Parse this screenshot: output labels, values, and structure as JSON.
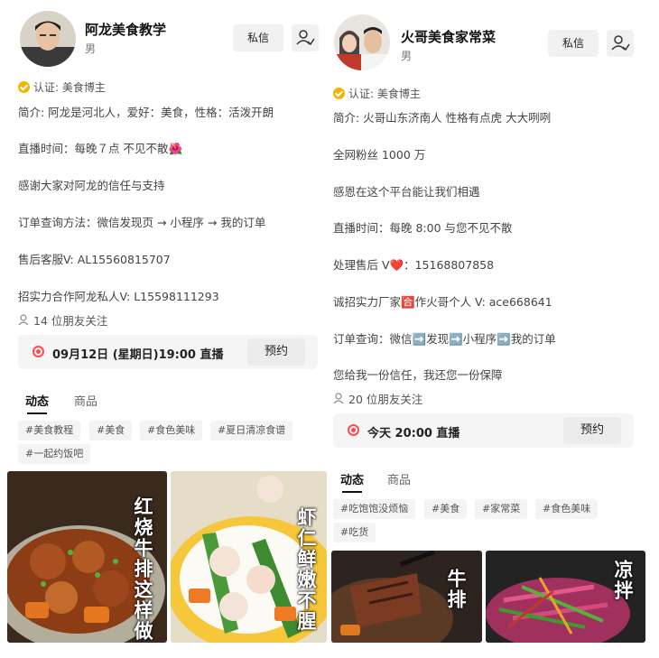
{
  "left": {
    "name": "阿龙美食教学",
    "gender": "男",
    "message_label": "私信",
    "verification": "认证: 美食博主",
    "bio_lines": [
      "简介: 阿龙是河北人，爱好：美食，性格：活泼开朗",
      "直播时间：每晚７点  不见不散🌺",
      "感谢大家对阿龙的信任与支持",
      "订单查询方法：微信发现页 → 小程序 → 我的订单",
      "售后客服V:    AL15560815707",
      "招实力合作阿龙私人V:  L15598111293"
    ],
    "friends": "14 位朋友关注",
    "live": {
      "text": "09月12日 (星期日)19:00 直播",
      "button": "预约"
    },
    "tabs": [
      "动态",
      "商品"
    ],
    "tags": [
      "#美食教程",
      "#美食",
      "#食色美味",
      "#夏日清凉食谱",
      "#一起约饭吧"
    ],
    "thumbnails": [
      {
        "caption": "红烧牛排这样做"
      },
      {
        "caption": "虾仁鲜嫩不腥"
      }
    ]
  },
  "right": {
    "name": "火哥美食家常菜",
    "gender": "男",
    "message_label": "私信",
    "verification": "认证: 美食博主",
    "bio_lines": [
      "简介: 火哥山东济南人 性格有点虎 大大咧咧",
      "全网粉丝 1000 万",
      "感恩在这个平台能让我们相遇",
      "直播时间：每晚 8:00 与您不见不散",
      "处理售后 V❤️：15168807858",
      "诚招实力厂家🈴作火哥个人 V:    ace668641",
      "订单查询：微信➡️发现➡️小程序➡️我的订单",
      "您给我一份信任，我还您一份保障"
    ],
    "friends": "20 位朋友关注",
    "live": {
      "text": "今天 20:00 直播",
      "button": "预约"
    },
    "tabs": [
      "动态",
      "商品"
    ],
    "tags": [
      "#吃饱饱没烦恼",
      "#美食",
      "#家常菜",
      "#食色美味",
      "#吃货"
    ],
    "thumbnails": [
      {
        "caption": "牛排"
      },
      {
        "caption": "凉拌"
      }
    ]
  }
}
